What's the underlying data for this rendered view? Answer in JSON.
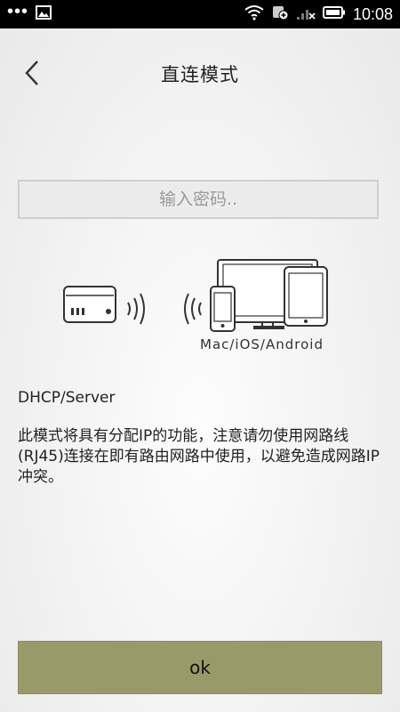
{
  "status_bar": {
    "time": "10:08",
    "icons": [
      "more-dots-icon",
      "image-notification-icon",
      "wifi-icon",
      "data-saver-icon",
      "signal-icon",
      "battery-icon"
    ]
  },
  "header": {
    "title": "直连模式",
    "back_icon": "chevron-left-icon"
  },
  "password": {
    "placeholder": "输入密码..",
    "value": ""
  },
  "illustration": {
    "device_caption": "Mac/iOS/Android",
    "icons": [
      "router-box-icon",
      "wifi-waves-icon",
      "monitor-icon",
      "phone-icon",
      "tablet-icon"
    ]
  },
  "mode": {
    "label": "DHCP/Server",
    "description": "此模式将具有分配IP的功能，注意请勿使用网路线(RJ45)连接在即有路由网路中使用，以避免造成网路IP冲突。"
  },
  "actions": {
    "ok_label": "ok"
  },
  "colors": {
    "status_bar": "#000000",
    "ok_button": "#999a6a",
    "input_border": "#cfcfcf"
  }
}
